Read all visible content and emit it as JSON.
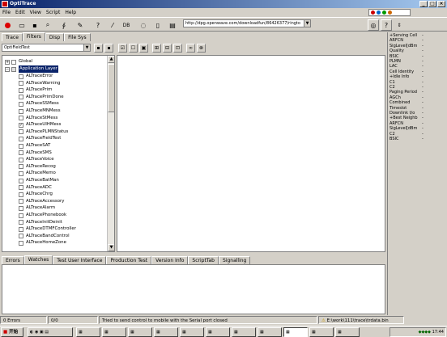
{
  "window": {
    "title": "OptiTrace"
  },
  "menu": [
    "File",
    "Edit",
    "View",
    "Script",
    "Help"
  ],
  "toolbar": {
    "db_label": "DB",
    "url": "http://dpg.openwave.com/downloadfun/86426377/ringto"
  },
  "top_tabs": [
    "Trace",
    "Filters",
    "Disp",
    "File Sys"
  ],
  "filter_bar": {
    "combo_value": "OptiFieldTest"
  },
  "tree": {
    "global": "Global",
    "app_layer": "Application Layer",
    "items": [
      {
        "label": "ALTraceError",
        "checked": false
      },
      {
        "label": "ALTraceWarning",
        "checked": false
      },
      {
        "label": "ALTracePrim",
        "checked": false
      },
      {
        "label": "ALTracePrimDone",
        "checked": false
      },
      {
        "label": "ALTraceSSMess",
        "checked": false
      },
      {
        "label": "ALTraceMNMess",
        "checked": false
      },
      {
        "label": "ALTraceStMess",
        "checked": false
      },
      {
        "label": "ALTraceUIHMess",
        "checked": true
      },
      {
        "label": "ALTracePLMNStatus",
        "checked": false
      },
      {
        "label": "ALTraceFieldTest",
        "checked": false
      },
      {
        "label": "ALTraceSAT",
        "checked": false
      },
      {
        "label": "ALTraceSMS",
        "checked": false
      },
      {
        "label": "ALTraceVoice",
        "checked": false
      },
      {
        "label": "ALTraceRecog",
        "checked": false
      },
      {
        "label": "ALTraceMemo",
        "checked": false
      },
      {
        "label": "ALTraceBatMan",
        "checked": false
      },
      {
        "label": "ALTraceADC",
        "checked": false
      },
      {
        "label": "ALTraceChrg",
        "checked": false
      },
      {
        "label": "ALTraceAccessory",
        "checked": false
      },
      {
        "label": "ALTraceAlarm",
        "checked": false
      },
      {
        "label": "ALTracePhonebook",
        "checked": false
      },
      {
        "label": "ALTraceInitDeinit",
        "checked": false
      },
      {
        "label": "ALTraceDTMFController",
        "checked": false
      },
      {
        "label": "ALTraceBandControl",
        "checked": false
      },
      {
        "label": "ALTraceHomeZone",
        "checked": false
      }
    ]
  },
  "side_panel": [
    {
      "label": "+Serving Cell",
      "value": "-"
    },
    {
      "label": "ARFCN",
      "value": "-"
    },
    {
      "label": "SigLevel[dBm",
      "value": "-"
    },
    {
      "label": "Quality",
      "value": "-"
    },
    {
      "label": "BSIC",
      "value": "-"
    },
    {
      "label": "PLMN",
      "value": "-"
    },
    {
      "label": "LAC",
      "value": "-"
    },
    {
      "label": "Cell Identity",
      "value": "-"
    },
    {
      "label": "+Idle Info",
      "value": "-"
    },
    {
      "label": "C1",
      "value": "-"
    },
    {
      "label": "C2",
      "value": "-"
    },
    {
      "label": "Paging Period",
      "value": "-"
    },
    {
      "label": "AGCh",
      "value": "-"
    },
    {
      "label": "Combined",
      "value": "-"
    },
    {
      "label": "Timeslot",
      "value": "-"
    },
    {
      "label": "Downlink t/o",
      "value": "-"
    },
    {
      "label": "+Best Neighb",
      "value": "-"
    },
    {
      "label": "ARFCN",
      "value": "-"
    },
    {
      "label": "SigLevel[dBm",
      "value": "-"
    },
    {
      "label": "C2",
      "value": "-"
    },
    {
      "label": "BSIC",
      "value": "-"
    }
  ],
  "bottom_tabs": [
    "Errors",
    "Watches",
    "Test User Interface",
    "Production Test",
    "Version Info",
    "ScriptTab",
    "Signalling"
  ],
  "status": {
    "errors": "0 Errors",
    "count": "0/0",
    "message": "Tried to send control to mobile with the Serial port closed",
    "file": "E:\\work\\111\\trace\\trdata.bin"
  },
  "taskbar": {
    "start": "开始",
    "clock": "17:44"
  }
}
